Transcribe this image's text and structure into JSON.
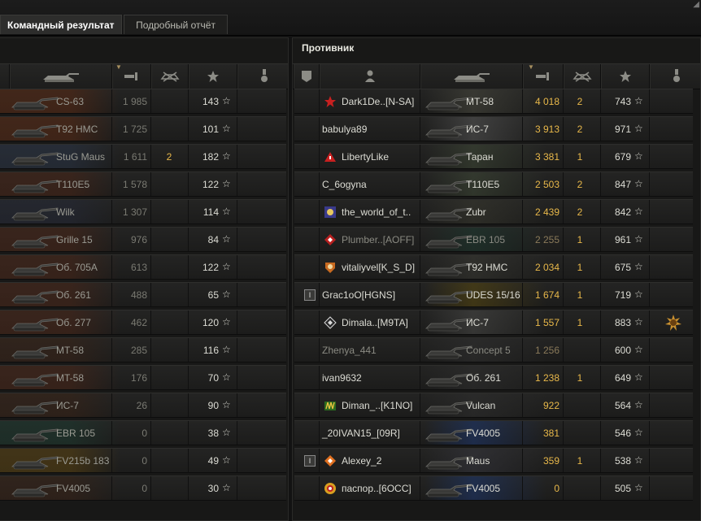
{
  "tabs": {
    "team_result": "Командный результат",
    "detailed_report": "Подробный отчёт"
  },
  "right_panel": {
    "title": "Противник"
  },
  "colors": {
    "gold": "#e8b84a",
    "dim": "#7a7a72",
    "text": "#dcdcd4"
  },
  "left_rows": [
    {
      "vehicle": "CS-63",
      "damage": "1 985",
      "kills": "",
      "xp": "143",
      "tint": "#5a2a14"
    },
    {
      "vehicle": "T92 HMC",
      "damage": "1 725",
      "kills": "",
      "xp": "101",
      "tint": "#5a2a14"
    },
    {
      "vehicle": "StuG Maus",
      "damage": "1 611",
      "kills": "2",
      "xp": "182",
      "tint": "#2a3446"
    },
    {
      "vehicle": "T110E5",
      "damage": "1 578",
      "kills": "",
      "xp": "122",
      "tint": "#4a2618"
    },
    {
      "vehicle": "Wilk",
      "damage": "1 307",
      "kills": "",
      "xp": "114",
      "tint": "#262a38"
    },
    {
      "vehicle": "Grille 15",
      "damage": "976",
      "kills": "",
      "xp": "84",
      "tint": "#4a2618"
    },
    {
      "vehicle": "Об. 705А",
      "damage": "613",
      "kills": "",
      "xp": "122",
      "tint": "#4a2618"
    },
    {
      "vehicle": "Об. 261",
      "damage": "488",
      "kills": "",
      "xp": "65",
      "tint": "#4a2618"
    },
    {
      "vehicle": "Об. 277",
      "damage": "462",
      "kills": "",
      "xp": "120",
      "tint": "#4a2618"
    },
    {
      "vehicle": "MT-58",
      "damage": "285",
      "kills": "",
      "xp": "116",
      "tint": "#3a2418"
    },
    {
      "vehicle": "MT-58",
      "damage": "176",
      "kills": "",
      "xp": "70",
      "tint": "#4a2618"
    },
    {
      "vehicle": "ИС-7",
      "damage": "26",
      "kills": "",
      "xp": "90",
      "tint": "#3a2418"
    },
    {
      "vehicle": "EBR 105",
      "damage": "0",
      "kills": "",
      "xp": "38",
      "tint": "#1e3a30"
    },
    {
      "vehicle": "FV215b 183",
      "damage": "0",
      "kills": "",
      "xp": "49",
      "tint": "#5a4210"
    },
    {
      "vehicle": "FV4005",
      "damage": "0",
      "kills": "",
      "xp": "30",
      "tint": "#3a2418"
    }
  ],
  "right_rows": [
    {
      "player": "Dark1De..[N-SA]",
      "vehicle": "MT-58",
      "damage": "4 018",
      "kills": "2",
      "xp": "743",
      "clan": "red-star-icon",
      "tint": "#4a4a40",
      "dim": false
    },
    {
      "player": "babulya89",
      "vehicle": "ИС-7",
      "damage": "3 913",
      "kills": "2",
      "xp": "971",
      "clan": "",
      "tint": "#585858",
      "dim": false
    },
    {
      "player": "LibertyLike",
      "vehicle": "Таран",
      "damage": "3 381",
      "kills": "1",
      "xp": "679",
      "clan": "red-triangle-icon",
      "tint": "#404a38",
      "dim": false
    },
    {
      "player": "C_6ogyna",
      "vehicle": "T110E5",
      "damage": "2 503",
      "kills": "2",
      "xp": "847",
      "clan": "",
      "tint": "#404a38",
      "dim": false
    },
    {
      "player": "the_world_of_t..",
      "vehicle": "Zubr",
      "damage": "2 439",
      "kills": "2",
      "xp": "842",
      "clan": "blue-crest-icon",
      "tint": "#3a3a30",
      "dim": false
    },
    {
      "player": "Plumber..[AOFF]",
      "vehicle": "EBR 105",
      "damage": "2 255",
      "kills": "1",
      "xp": "961",
      "clan": "red-diamond-icon",
      "tint": "#1e3a30",
      "dim": true
    },
    {
      "player": "vitaliyvel[K_S_D]",
      "vehicle": "T92 HMC",
      "damage": "2 034",
      "kills": "1",
      "xp": "675",
      "clan": "orange-shield-icon",
      "tint": "#3a3a34",
      "dim": false
    },
    {
      "player": "Grac1oO[HGNS]",
      "vehicle": "UDES 15/16",
      "damage": "1 674",
      "kills": "1",
      "xp": "719",
      "clan": "",
      "tint": "#5a4a10",
      "dim": false
    },
    {
      "player": "Dimala..[M9TA]",
      "vehicle": "ИС-7",
      "damage": "1 557",
      "kills": "1",
      "xp": "883",
      "clan": "black-diamond-icon",
      "tint": "#4a4a48",
      "dim": false
    },
    {
      "player": "Zhenya_441",
      "vehicle": "Concept 5",
      "damage": "1 256",
      "kills": "",
      "xp": "600",
      "clan": "",
      "tint": "#303030",
      "dim": true
    },
    {
      "player": "ivan9632",
      "vehicle": "Об. 261",
      "damage": "1 238",
      "kills": "1",
      "xp": "649",
      "clan": "",
      "tint": "#303030",
      "dim": false
    },
    {
      "player": "Diman_..[K1NO]",
      "vehicle": "Vulcan",
      "damage": "922",
      "kills": "",
      "xp": "564",
      "clan": "green-gold-icon",
      "tint": "#303030",
      "dim": false
    },
    {
      "player": "_20IVAN15_[09R]",
      "vehicle": "FV4005",
      "damage": "381",
      "kills": "",
      "xp": "546",
      "clan": "",
      "tint": "#1e3870",
      "dim": false
    },
    {
      "player": "Alexey_2",
      "vehicle": "Maus",
      "damage": "359",
      "kills": "1",
      "xp": "538",
      "clan": "orange-diamond-icon",
      "tint": "#383840",
      "dim": false
    },
    {
      "player": "пacпop..[6OCC]",
      "vehicle": "FV4005",
      "damage": "0",
      "kills": "",
      "xp": "505",
      "clan": "colorful-crest-icon",
      "tint": "#1e3870",
      "dim": false
    }
  ]
}
